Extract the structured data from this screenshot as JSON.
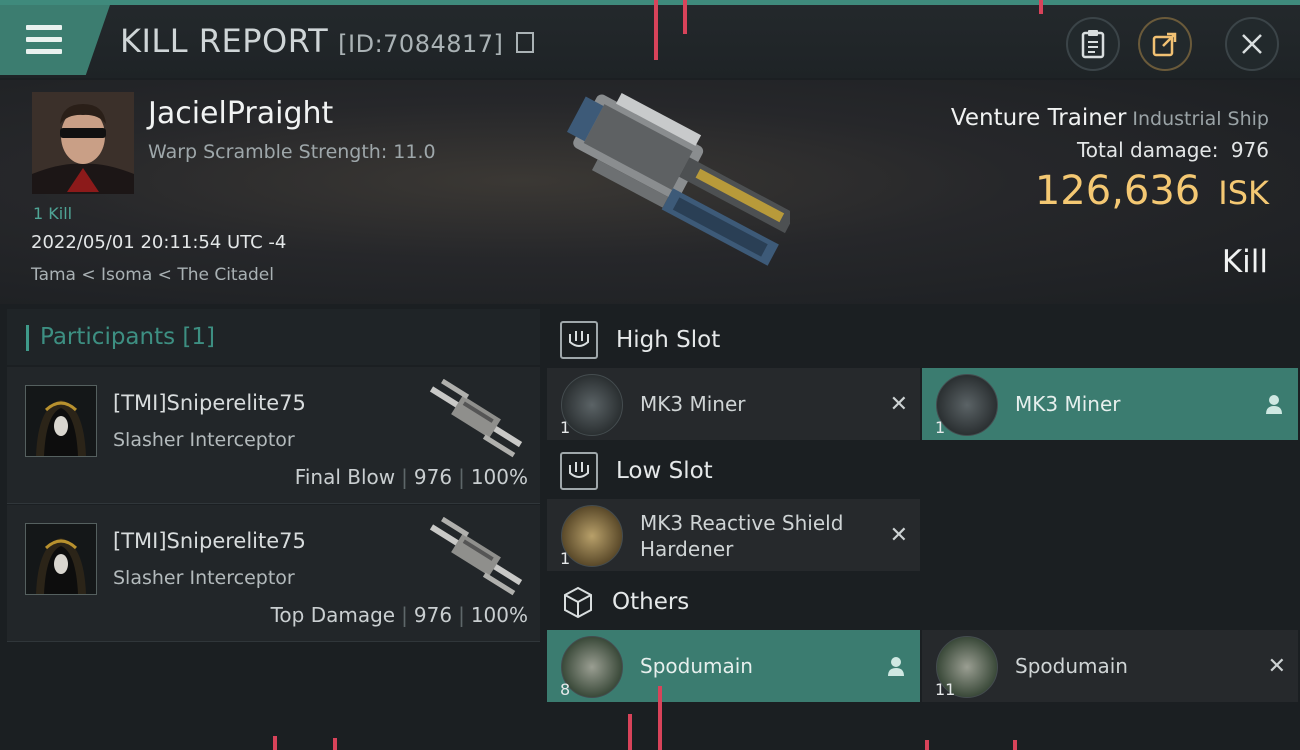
{
  "header": {
    "title": "KILL REPORT",
    "id_label": "[ID:7084817]"
  },
  "victim": {
    "pilot_name": "JacielPraight",
    "warp_scramble": "Warp Scramble Strength: 11.0",
    "kills": "1 Kill",
    "timestamp": "2022/05/01 20:11:54 UTC -4",
    "location": "Tama < Isoma < The Citadel",
    "ship_name": "Venture Trainer",
    "ship_class": "Industrial Ship",
    "total_damage_label": "Total damage:",
    "total_damage_value": "976",
    "isk_value": "126,636",
    "isk_unit": "ISK",
    "result": "Kill"
  },
  "participants": {
    "title": "Participants [1]",
    "rows": [
      {
        "name": "[TMI]Sniperelite75",
        "ship": "Slasher Interceptor",
        "label": "Final Blow",
        "damage": "976",
        "percent": "100%"
      },
      {
        "name": "[TMI]Sniperelite75",
        "ship": "Slasher Interceptor",
        "label": "Top Damage",
        "damage": "976",
        "percent": "100%"
      }
    ]
  },
  "fitting": {
    "high_slot": {
      "title": "High Slot",
      "items": [
        {
          "name": "MK3 Miner",
          "qty": "1",
          "state": "destroyed"
        },
        {
          "name": "MK3 Miner",
          "qty": "1",
          "state": "dropped"
        }
      ]
    },
    "low_slot": {
      "title": "Low Slot",
      "items": [
        {
          "name": "MK3 Reactive Shield",
          "name2": "Hardener",
          "qty": "1",
          "state": "destroyed"
        }
      ]
    },
    "others": {
      "title": "Others",
      "items": [
        {
          "name": "Spodumain",
          "qty": "8",
          "state": "dropped"
        },
        {
          "name": "Spodumain",
          "qty": "11",
          "state": "destroyed"
        }
      ]
    }
  },
  "icons": {
    "menu": "hamburger-menu-icon",
    "clipboard": "clipboard-icon",
    "share": "share-icon",
    "close": "close-icon",
    "copy": "copy-icon"
  },
  "colors": {
    "accent": "#3b7c70",
    "isk": "#f4c873",
    "participant_title": "#3d8f82"
  }
}
